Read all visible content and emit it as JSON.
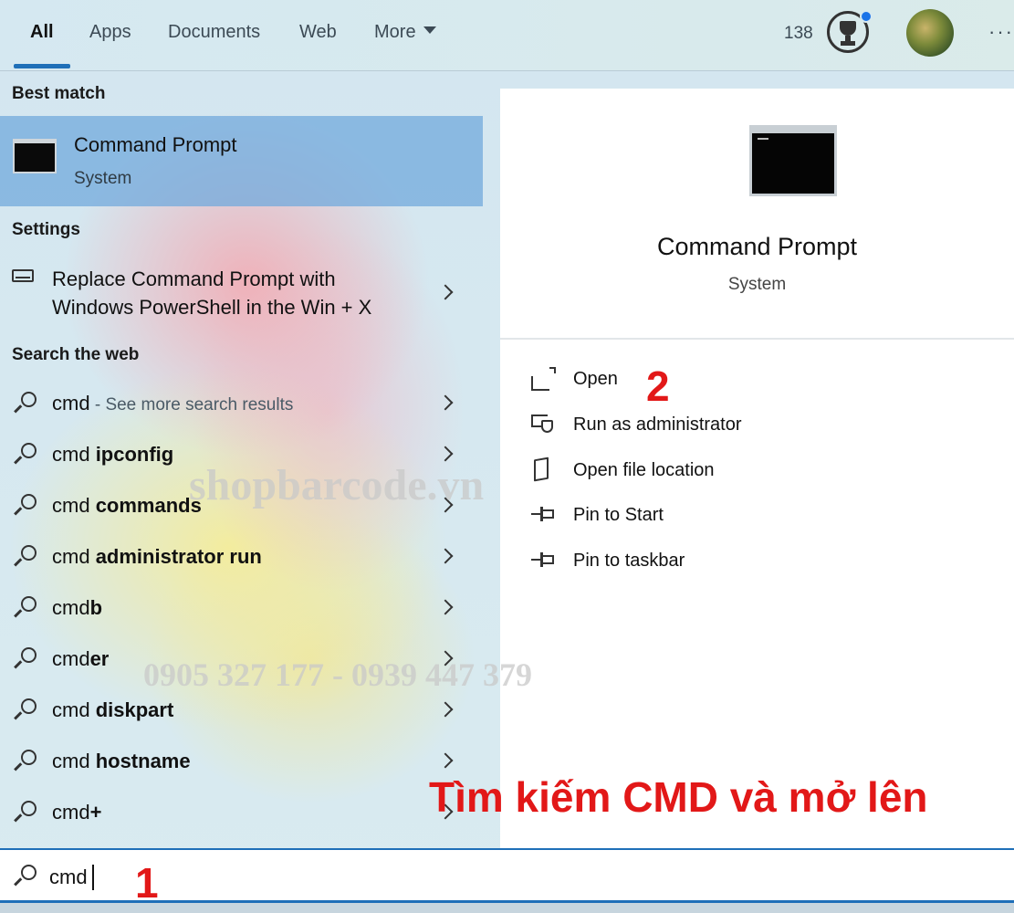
{
  "tabs": {
    "all": "All",
    "apps": "Apps",
    "documents": "Documents",
    "web": "Web",
    "more": "More"
  },
  "header": {
    "points": "138",
    "more_options": "···"
  },
  "sections": {
    "best_match": "Best match",
    "settings": "Settings",
    "search_web": "Search the web"
  },
  "best_match": {
    "title": "Command Prompt",
    "subtitle": "System"
  },
  "setting_item": {
    "line1": "Replace Command Prompt with",
    "line2": "Windows PowerShell in the Win + X"
  },
  "web_results": [
    {
      "prefix": "cmd",
      "bold": "",
      "hint": " - See more search results"
    },
    {
      "prefix": "cmd ",
      "bold": "ipconfig",
      "hint": ""
    },
    {
      "prefix": "cmd ",
      "bold": "commands",
      "hint": ""
    },
    {
      "prefix": "cmd ",
      "bold": "administrator run",
      "hint": ""
    },
    {
      "prefix": "cmd",
      "bold": "b",
      "hint": ""
    },
    {
      "prefix": "cmd",
      "bold": "er",
      "hint": ""
    },
    {
      "prefix": "cmd ",
      "bold": "diskpart",
      "hint": ""
    },
    {
      "prefix": "cmd ",
      "bold": "hostname",
      "hint": ""
    },
    {
      "prefix": "cmd",
      "bold": "+",
      "hint": ""
    }
  ],
  "preview": {
    "title": "Command Prompt",
    "subtitle": "System",
    "actions": {
      "open": "Open",
      "run_admin": "Run as administrator",
      "open_location": "Open file location",
      "pin_start": "Pin to Start",
      "pin_taskbar": "Pin to taskbar"
    }
  },
  "search": {
    "value": "cmd"
  },
  "annotations": {
    "step1": "1",
    "step2": "2",
    "caption": "Tìm kiếm CMD và mở lên"
  },
  "watermark": {
    "site": "shopbarcode.vn",
    "phone": "0905 327 177 - 0939 447 379"
  },
  "colors": {
    "accent": "#1f6fb8",
    "selected_bg": "#71aadc",
    "annotation_red": "#e21818",
    "badge_blue": "#1a73e8"
  }
}
